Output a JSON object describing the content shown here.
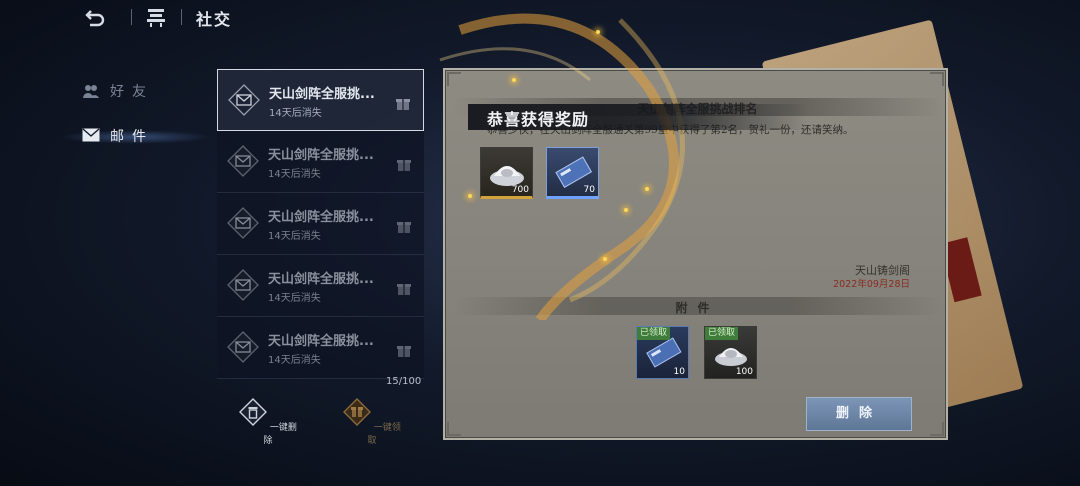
{
  "topbar": {
    "back_icon": "back-arrow-icon",
    "home_icon": "pavilion-icon",
    "title": "社交"
  },
  "sidebar": {
    "items": [
      {
        "label": "好友",
        "icon": "friends-icon",
        "active": false
      },
      {
        "label": "邮件",
        "icon": "mail-icon",
        "active": true
      }
    ]
  },
  "mail_list": {
    "items": [
      {
        "title": "天山剑阵全服挑...",
        "subtitle": "14天后消失",
        "selected": true,
        "read": false
      },
      {
        "title": "天山剑阵全服挑...",
        "subtitle": "14天后消失",
        "selected": false,
        "read": true
      },
      {
        "title": "天山剑阵全服挑...",
        "subtitle": "14天后消失",
        "selected": false,
        "read": true
      },
      {
        "title": "天山剑阵全服挑...",
        "subtitle": "14天后消失",
        "selected": false,
        "read": true
      },
      {
        "title": "天山剑阵全服挑...",
        "subtitle": "14天后消失",
        "selected": false,
        "read": true
      }
    ],
    "count": "15/100"
  },
  "actions": {
    "delete_all": "一键删除",
    "collect_all": "一键领取"
  },
  "letter": {
    "title": "天山剑阵全服挑战排名",
    "body": "恭喜少侠，在天山剑阵全服通关第99重中获得了第2名，贺礼一份，还请笑纳。",
    "signature": "天山铸剑阁",
    "date": "2022年09月28日",
    "attachment_label": "附件",
    "attachments": [
      {
        "status": "已领取",
        "quantity": "10",
        "icon": "token-card-icon"
      },
      {
        "status": "已领取",
        "quantity": "100",
        "icon": "silver-ingot-icon"
      }
    ],
    "delete_label": "删除"
  },
  "reward_popup": {
    "title": "恭喜获得奖励",
    "items": [
      {
        "quantity": "700",
        "icon": "silver-ingot-icon"
      },
      {
        "quantity": "70",
        "icon": "token-card-icon"
      }
    ]
  },
  "colors": {
    "claimed_badge": "#3f7d3a",
    "date_red": "#8a2c22",
    "delete_button": "#6f87a8",
    "gold_rarity": "#d4a23a",
    "blue_rarity": "#6fa1ff"
  }
}
